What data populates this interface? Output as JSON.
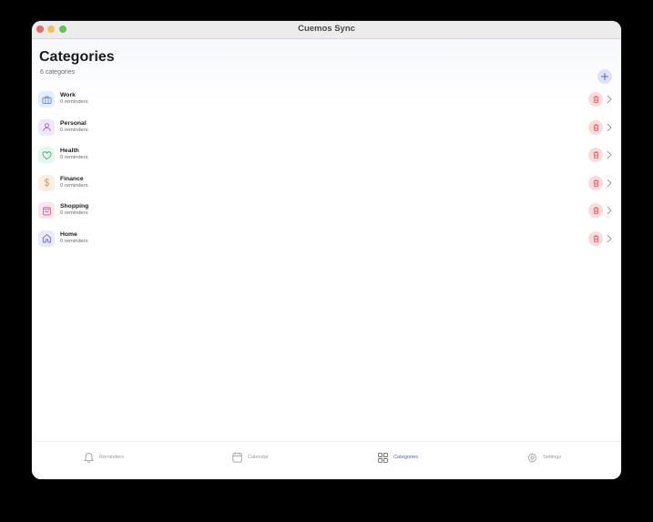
{
  "window": {
    "title": "Cuemos Sync"
  },
  "header": {
    "title": "Categories",
    "subtitle": "6 categories"
  },
  "categories": [
    {
      "name": "Work",
      "count": "0 reminders",
      "icon": "briefcase-icon",
      "color": "#4f83e6",
      "bg": "#e6eefc"
    },
    {
      "name": "Personal",
      "count": "0 reminders",
      "icon": "person-icon",
      "color": "#a05ad8",
      "bg": "#f1e7fb"
    },
    {
      "name": "Health",
      "count": "0 reminders",
      "icon": "heart-icon",
      "color": "#3aaa6a",
      "bg": "#e5f6ec"
    },
    {
      "name": "Finance",
      "count": "0 reminders",
      "icon": "dollar-icon",
      "color": "#e59436",
      "bg": "#fcefdf"
    },
    {
      "name": "Shopping",
      "count": "0 reminders",
      "icon": "shopping-bag-icon",
      "color": "#e04a86",
      "bg": "#fce4ee"
    },
    {
      "name": "Home",
      "count": "0 reminders",
      "icon": "house-icon",
      "color": "#5a5fd0",
      "bg": "#e8e9fb"
    }
  ],
  "tabs": [
    {
      "label": "Reminders",
      "icon": "bell-icon",
      "active": false
    },
    {
      "label": "Calendar",
      "icon": "calendar-icon",
      "active": false
    },
    {
      "label": "Categories",
      "icon": "grid-icon",
      "active": true
    },
    {
      "label": "Settings",
      "icon": "gear-icon",
      "active": false
    }
  ],
  "colors": {
    "accent": "#5a5fd0",
    "delete": "#d9534f",
    "delete_bg": "#f6dcdc",
    "add_bg": "#dfe1f7"
  }
}
